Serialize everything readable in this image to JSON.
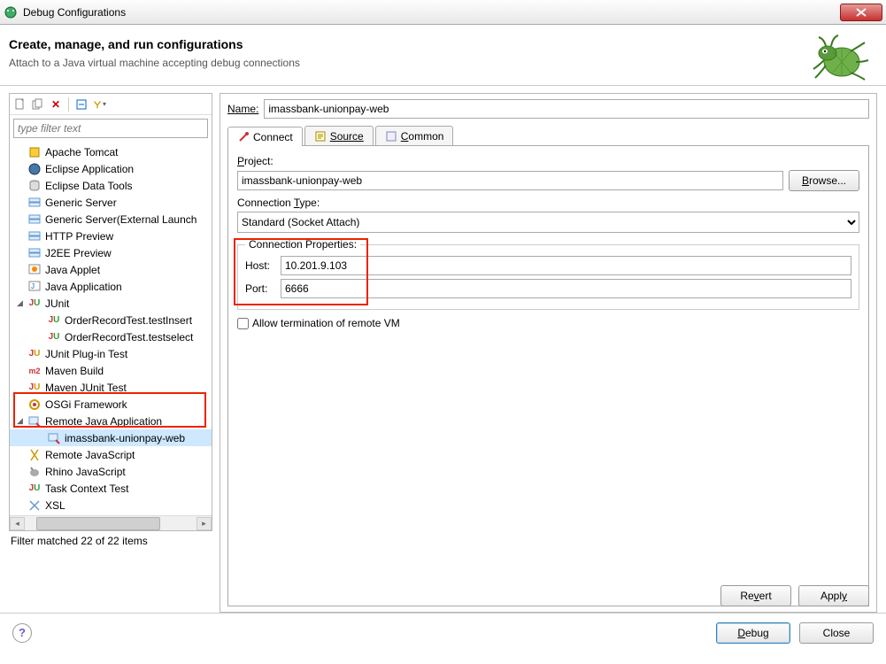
{
  "titlebar": {
    "title": "Debug Configurations"
  },
  "header": {
    "title": "Create, manage, and run configurations",
    "subtitle": "Attach to a Java virtual machine accepting debug connections"
  },
  "filter": {
    "placeholder": "type filter text",
    "status": "Filter matched 22 of 22 items"
  },
  "tree": [
    {
      "icon": "tomcat",
      "label": "Apache Tomcat"
    },
    {
      "icon": "eclipse",
      "label": "Eclipse Application"
    },
    {
      "icon": "db",
      "label": "Eclipse Data Tools"
    },
    {
      "icon": "server",
      "label": "Generic Server"
    },
    {
      "icon": "server",
      "label": "Generic Server(External Launch"
    },
    {
      "icon": "server",
      "label": "HTTP Preview"
    },
    {
      "icon": "server",
      "label": "J2EE Preview"
    },
    {
      "icon": "applet",
      "label": "Java Applet"
    },
    {
      "icon": "java",
      "label": "Java Application"
    },
    {
      "icon": "junit",
      "label": "JUnit",
      "expanded": true,
      "children": [
        {
          "icon": "junit",
          "label": "OrderRecordTest.testInsert"
        },
        {
          "icon": "junit",
          "label": "OrderRecordTest.testselect"
        }
      ]
    },
    {
      "icon": "junitplug",
      "label": "JUnit Plug-in Test"
    },
    {
      "icon": "maven",
      "label": "Maven Build"
    },
    {
      "icon": "junitplug",
      "label": "Maven JUnit Test"
    },
    {
      "icon": "osgi",
      "label": "OSGi Framework"
    },
    {
      "icon": "remote",
      "label": "Remote Java Application",
      "expanded": true,
      "children": [
        {
          "icon": "remote",
          "label": "imassbank-unionpay-web",
          "selected": true
        }
      ]
    },
    {
      "icon": "js",
      "label": "Remote JavaScript"
    },
    {
      "icon": "rhino",
      "label": "Rhino JavaScript"
    },
    {
      "icon": "junit",
      "label": "Task Context Test"
    },
    {
      "icon": "xsl",
      "label": "XSL"
    }
  ],
  "name": {
    "label": "Name:",
    "value": "imassbank-unionpay-web"
  },
  "tabs": {
    "connect": "Connect",
    "source": "Source",
    "common": "Common"
  },
  "connect": {
    "project_label": "Project:",
    "project_value": "imassbank-unionpay-web",
    "browse": "Browse...",
    "conn_type_label": "Connection Type:",
    "conn_type_value": "Standard (Socket Attach)",
    "conn_props_label": "Connection Properties:",
    "host_label": "Host:",
    "host_value": "10.201.9.103",
    "port_label": "Port:",
    "port_value": "6666",
    "allow_term": "Allow termination of remote VM"
  },
  "buttons": {
    "revert": "Revert",
    "apply": "Apply",
    "debug": "Debug",
    "close": "Close"
  }
}
